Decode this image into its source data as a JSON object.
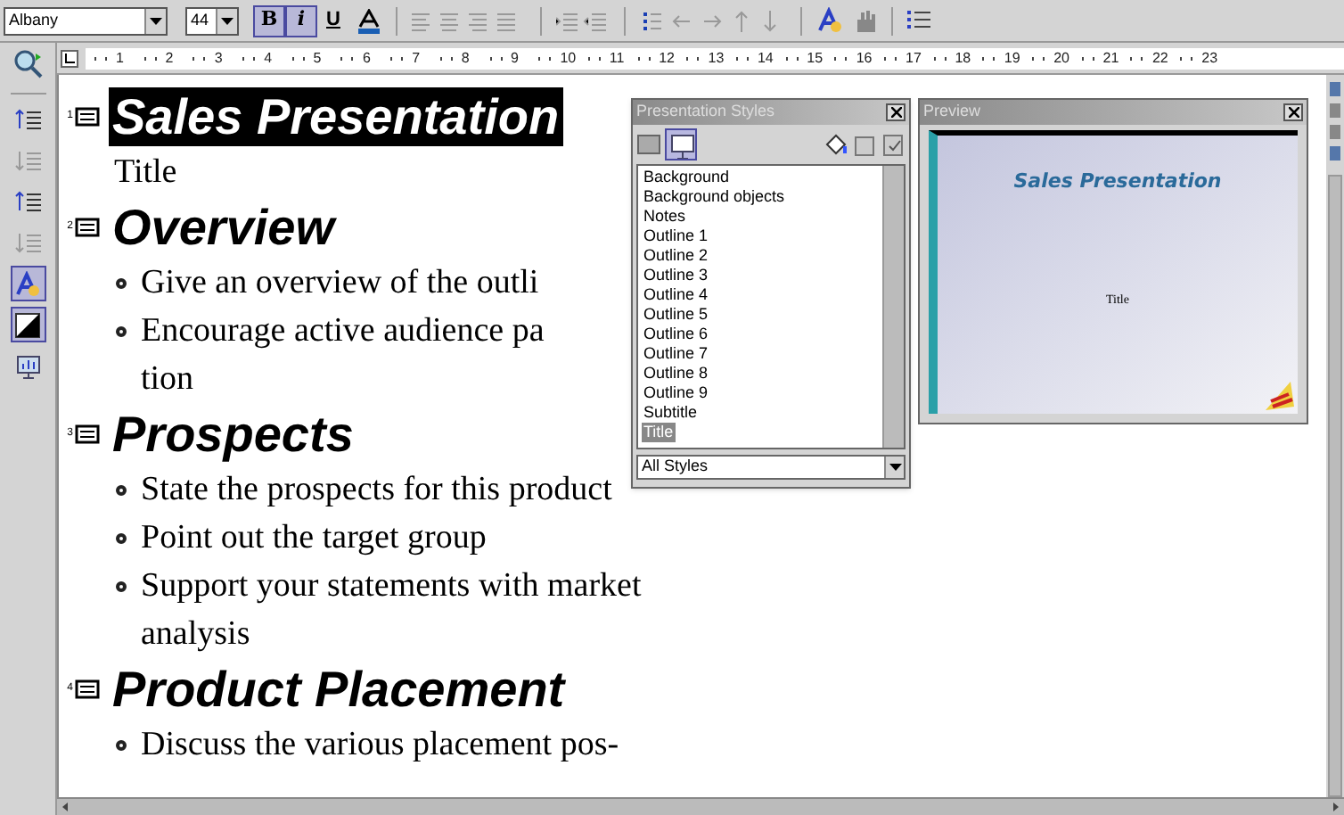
{
  "toolbar": {
    "font_name": "Albany",
    "font_size": "44",
    "format_buttons": [
      {
        "label": "B",
        "selected": true
      },
      {
        "label": "i",
        "selected": true
      },
      {
        "label": "U",
        "selected": false
      }
    ]
  },
  "ruler": {
    "labels": [
      "1",
      "2",
      "3",
      "4",
      "5",
      "6",
      "7",
      "8",
      "9",
      "10",
      "11",
      "12",
      "13",
      "14",
      "15",
      "16",
      "17",
      "18",
      "19",
      "20",
      "21",
      "22",
      "23"
    ]
  },
  "left_toolbar": {
    "tools": [
      {
        "kind": "promote",
        "selected": false
      },
      {
        "kind": "demote",
        "selected": false
      },
      {
        "kind": "move-up",
        "selected": false
      },
      {
        "kind": "move-down",
        "selected": false
      },
      {
        "kind": "formatting",
        "selected": true
      },
      {
        "kind": "black-white",
        "selected": true
      },
      {
        "kind": "slide-show",
        "selected": false
      }
    ]
  },
  "outline": [
    {
      "number": "1",
      "title": "Sales Presentation",
      "selected": true,
      "items": [
        {
          "kind": "plain",
          "lines": [
            "Title"
          ]
        }
      ]
    },
    {
      "number": "2",
      "title": "Overview",
      "selected": false,
      "items": [
        {
          "kind": "bullet",
          "lines": [
            "Give an overview of the outli"
          ]
        },
        {
          "kind": "bullet",
          "lines": [
            "Encourage active audience pa",
            "tion"
          ]
        }
      ]
    },
    {
      "number": "3",
      "title": "Prospects",
      "selected": false,
      "items": [
        {
          "kind": "bullet",
          "lines": [
            "State the prospects for this product"
          ]
        },
        {
          "kind": "bullet",
          "lines": [
            "Point out the target group"
          ]
        },
        {
          "kind": "bullet",
          "lines": [
            "Support your statements with market",
            "analysis"
          ]
        }
      ]
    },
    {
      "number": "4",
      "title": "Product Placement",
      "selected": false,
      "items": [
        {
          "kind": "bullet",
          "lines": [
            "Discuss the various placement pos-"
          ]
        }
      ]
    }
  ],
  "styles_window": {
    "title": "Presentation Styles",
    "styles": [
      {
        "label": "Background",
        "selected": false
      },
      {
        "label": "Background objects",
        "selected": false
      },
      {
        "label": "Notes",
        "selected": false
      },
      {
        "label": "Outline 1",
        "selected": false
      },
      {
        "label": "Outline 2",
        "selected": false
      },
      {
        "label": "Outline 3",
        "selected": false
      },
      {
        "label": "Outline 4",
        "selected": false
      },
      {
        "label": "Outline 5",
        "selected": false
      },
      {
        "label": "Outline 6",
        "selected": false
      },
      {
        "label": "Outline 7",
        "selected": false
      },
      {
        "label": "Outline 8",
        "selected": false
      },
      {
        "label": "Outline 9",
        "selected": false
      },
      {
        "label": "Subtitle",
        "selected": false
      },
      {
        "label": "Title",
        "selected": true
      }
    ],
    "filter": "All Styles"
  },
  "preview_window": {
    "title": "Preview",
    "slide_title": "Sales Presentation",
    "slide_subtitle": "Title"
  }
}
